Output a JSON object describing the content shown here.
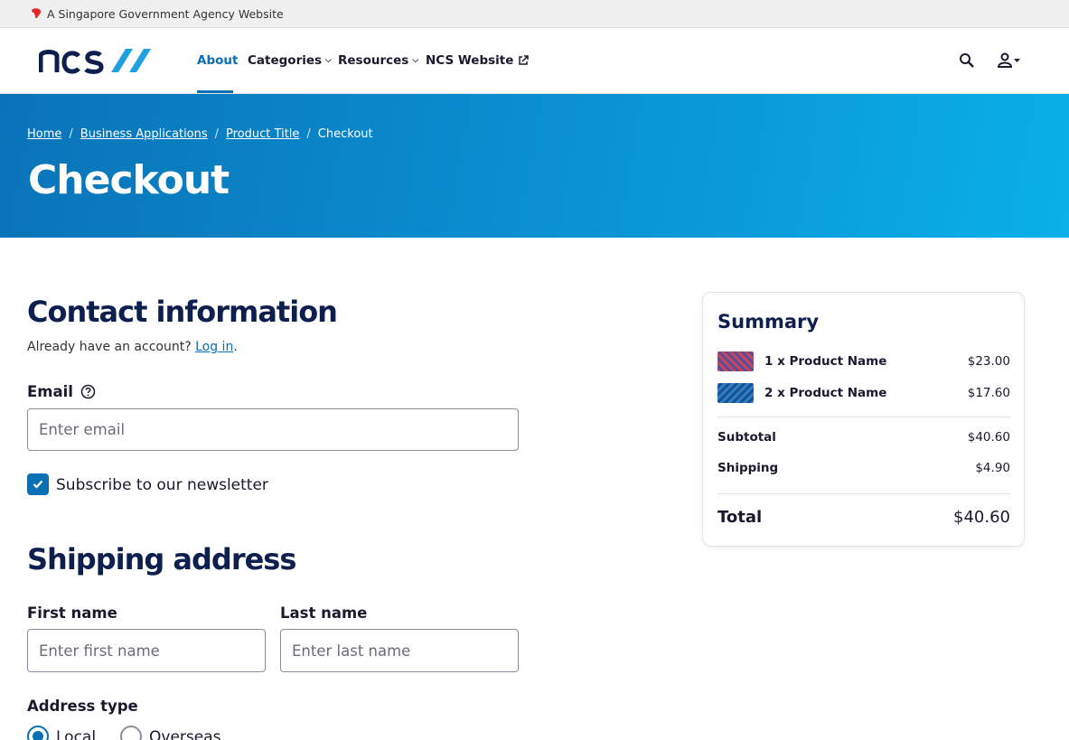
{
  "masthead": {
    "text": "A Singapore Government Agency Website"
  },
  "nav": {
    "about": "About",
    "categories": "Categories",
    "resources": "Resources",
    "ncs_website": "NCS Website"
  },
  "breadcrumb": {
    "home": "Home",
    "business": "Business Applications",
    "product": "Product Title",
    "current": "Checkout",
    "separator": "/"
  },
  "hero": {
    "title": "Checkout"
  },
  "contact": {
    "title": "Contact information",
    "account_prefix": "Already have an account?",
    "login_link": "Log in",
    "account_suffix": ".",
    "email_label": "Email",
    "email_placeholder": "Enter email",
    "newsletter_label": "Subscribe to our newsletter",
    "newsletter_checked": true
  },
  "shipping": {
    "title": "Shipping address",
    "first_name_label": "First name",
    "first_name_placeholder": "Enter first name",
    "last_name_label": "Last name",
    "last_name_placeholder": "Enter last name",
    "address_type_label": "Address type",
    "address_options": [
      "Local",
      "Overseas"
    ],
    "address_selected": "Local"
  },
  "summary": {
    "title": "Summary",
    "items": [
      {
        "name": "1 x Product Name",
        "price": "$23.00"
      },
      {
        "name": "2 x Product Name",
        "price": "$17.60"
      }
    ],
    "subtotal_label": "Subtotal",
    "subtotal": "$40.60",
    "shipping_label": "Shipping",
    "shipping": "$4.90",
    "total_label": "Total",
    "total": "$40.60"
  },
  "colors": {
    "primary": "#0a6fb5",
    "heading": "#0d1f4f",
    "hero_start": "#0a73b8",
    "hero_end": "#0ab0e8"
  },
  "icons": [
    "lion-head-icon",
    "ncs-logo",
    "chevron-down-icon",
    "external-link-icon",
    "search-icon",
    "user-icon",
    "help-icon",
    "check-icon"
  ]
}
